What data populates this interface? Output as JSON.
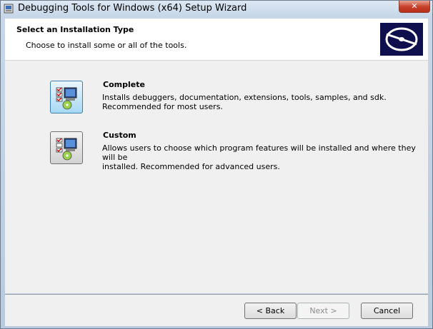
{
  "window": {
    "title": "Debugging Tools for Windows (x64) Setup Wizard",
    "close_label": "✕"
  },
  "header": {
    "heading": "Select an Installation Type",
    "subheading": "Choose to install some or all of the tools."
  },
  "options": [
    {
      "title": "Complete",
      "description_line1": "Installs debuggers, documentation, extensions, tools, samples, and sdk.",
      "description_line2": "Recommended for most users."
    },
    {
      "title": "Custom",
      "description_line1": "Allows users to choose which program features will be installed and where they will be",
      "description_line2": "installed. Recommended for advanced users."
    }
  ],
  "footer": {
    "back_label": "< Back",
    "next_label": "Next >",
    "cancel_label": "Cancel"
  },
  "icons": {
    "app": "installer-icon",
    "logo": "debug-disc-logo",
    "complete": "complete-install-icon",
    "custom": "custom-install-icon"
  },
  "colors": {
    "selected_option": "#a7d9f5",
    "logo_bg": "#0f0f4e"
  }
}
